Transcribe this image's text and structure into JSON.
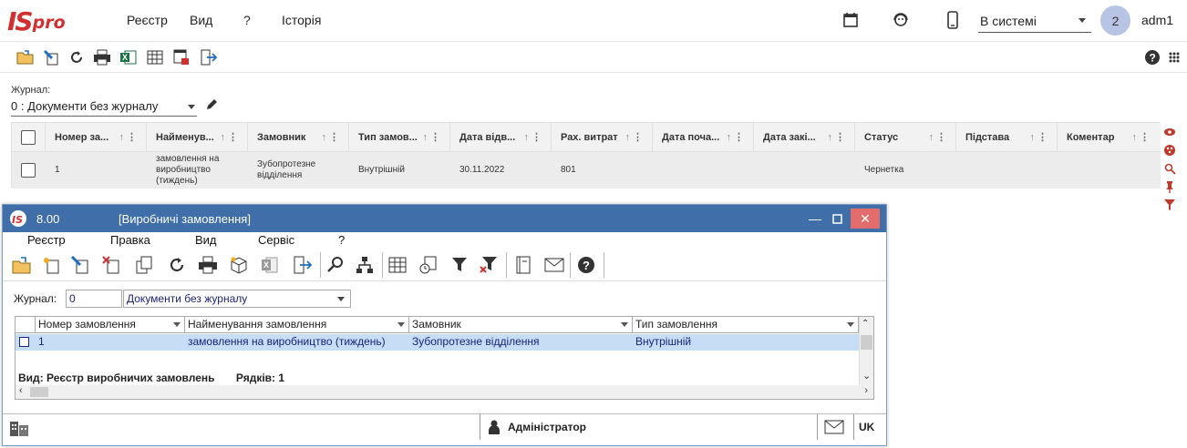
{
  "app": {
    "menu": [
      "Реєстр",
      "Вид",
      "?",
      "Історія"
    ],
    "system_select": "В системі",
    "avatar_number": "2",
    "username": "adm1"
  },
  "journal": {
    "label": "Журнал:",
    "value": "0 : Документи без журналу"
  },
  "grid": {
    "columns": [
      "Номер за...",
      "Найменув...",
      "Замовник",
      "Тип замов...",
      "Дата відв...",
      "Рах. витрат",
      "Дата поча...",
      "Дата закі...",
      "Статус",
      "Підстава",
      "Коментар"
    ],
    "row": {
      "number": "1",
      "name": "замовлення на виробництво (тиждень)",
      "customer": "Зубопротезне відділення",
      "type": "Внутрішній",
      "date": "30.11.2022",
      "account": "801",
      "status": "Чернетка"
    }
  },
  "window": {
    "version": "8.00",
    "title": "[Виробничі замовлення]",
    "menu": [
      "Реєстр",
      "Правка",
      "Вид",
      "Сервіс",
      "?"
    ],
    "journal_label": "Журнал:",
    "journal_number": "0",
    "journal_name": "Документи без журналу",
    "columns": [
      "Номер замовлення",
      "Найменування замовлення",
      "Замовник",
      "Тип замовлення"
    ],
    "row": [
      "1",
      "замовлення на виробництво (тиждень)",
      "Зубопротезне відділення",
      "Внутрішній"
    ],
    "view_info": "Вид: Реєстр виробничих замовлень",
    "rows_info": "Рядків: 1",
    "status_user": "Адміністратор",
    "status_lang": "UK"
  }
}
